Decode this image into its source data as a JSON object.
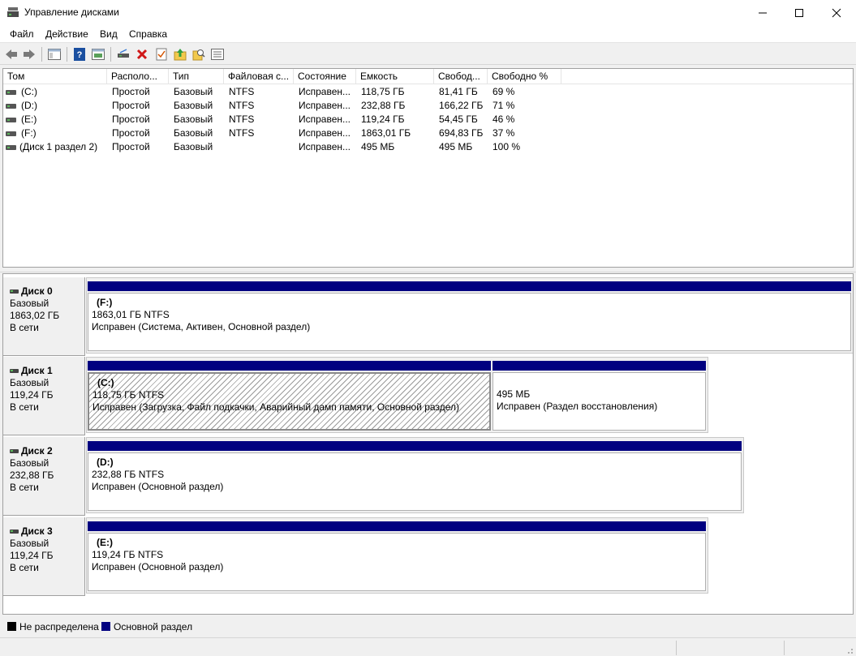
{
  "window": {
    "title": "Управление дисками",
    "controls": {
      "minimize": "—",
      "maximize": "☐",
      "close": "✕"
    }
  },
  "menu": [
    "Файл",
    "Действие",
    "Вид",
    "Справка"
  ],
  "toolbar_icons": [
    "back-arrow-icon",
    "forward-arrow-icon",
    "console-tree-icon",
    "help-icon",
    "properties-icon",
    "disk-link-icon",
    "delete-icon",
    "checklist-icon",
    "up-folder-icon",
    "search-icon",
    "rescan-icon"
  ],
  "volume_table": {
    "columns": [
      "Том",
      "Располо...",
      "Тип",
      "Файловая с...",
      "Состояние",
      "Емкость",
      "Свобод...",
      "Свободно %"
    ],
    "rows": [
      [
        "(C:)",
        "Простой",
        "Базовый",
        "NTFS",
        "Исправен...",
        "118,75 ГБ",
        "81,41 ГБ",
        "69 %"
      ],
      [
        "(D:)",
        "Простой",
        "Базовый",
        "NTFS",
        "Исправен...",
        "232,88 ГБ",
        "166,22 ГБ",
        "71 %"
      ],
      [
        "(E:)",
        "Простой",
        "Базовый",
        "NTFS",
        "Исправен...",
        "119,24 ГБ",
        "54,45 ГБ",
        "46 %"
      ],
      [
        "(F:)",
        "Простой",
        "Базовый",
        "NTFS",
        "Исправен...",
        "1863,01 ГБ",
        "694,83 ГБ",
        "37 %"
      ],
      [
        "(Диск 1 раздел 2)",
        "Простой",
        "Базовый",
        "",
        "Исправен...",
        "495 МБ",
        "495 МБ",
        "100 %"
      ]
    ]
  },
  "disks": [
    {
      "name": "Диск 0",
      "type": "Базовый",
      "size": "1863,02 ГБ",
      "status": "В сети",
      "partitions": [
        {
          "title": "(F:)",
          "size": "1863,01 ГБ NTFS",
          "status": "Исправен (Система, Активен, Основной раздел)"
        }
      ]
    },
    {
      "name": "Диск 1",
      "type": "Базовый",
      "size": "119,24 ГБ",
      "status": "В сети",
      "partitions": [
        {
          "title": "(C:)",
          "size": "118,75 ГБ NTFS",
          "status": "Исправен (Загрузка, Файл подкачки, Аварийный дамп памяти, Основной раздел)"
        },
        {
          "title": "",
          "size": "495 МБ",
          "status": "Исправен (Раздел восстановления)"
        }
      ]
    },
    {
      "name": "Диск 2",
      "type": "Базовый",
      "size": "232,88 ГБ",
      "status": "В сети",
      "partitions": [
        {
          "title": "(D:)",
          "size": "232,88 ГБ NTFS",
          "status": "Исправен (Основной раздел)"
        }
      ]
    },
    {
      "name": "Диск 3",
      "type": "Базовый",
      "size": "119,24 ГБ",
      "status": "В сети",
      "partitions": [
        {
          "title": "(E:)",
          "size": "119,24 ГБ NTFS",
          "status": "Исправен (Основной раздел)"
        }
      ]
    }
  ],
  "legend": [
    {
      "label": "Не распределена",
      "color": "#000000"
    },
    {
      "label": "Основной раздел",
      "color": "#000080"
    }
  ]
}
